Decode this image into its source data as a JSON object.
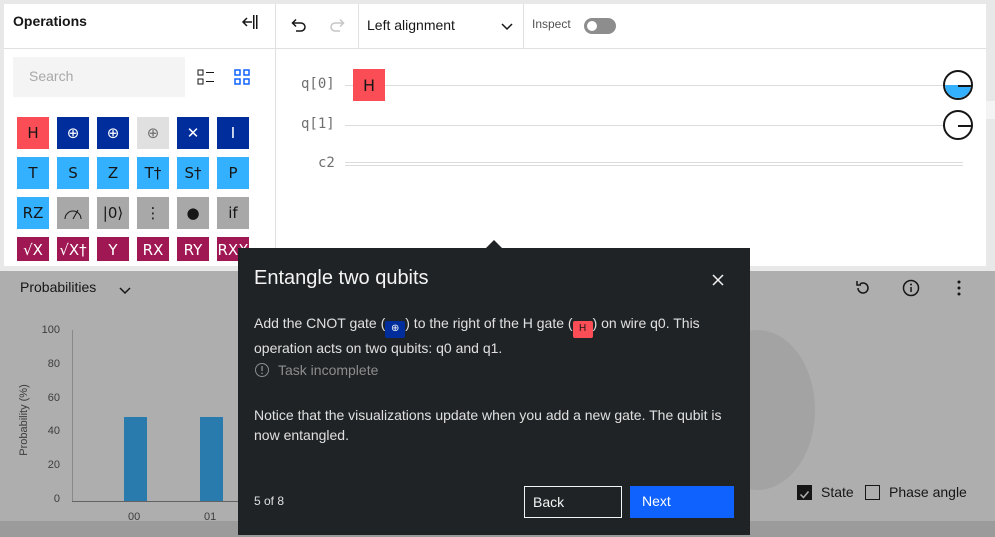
{
  "operations": {
    "title": "Operations",
    "search_placeholder": "Search",
    "gates": [
      {
        "label": "H",
        "style": "red"
      },
      {
        "label": "⊕",
        "style": "navy"
      },
      {
        "label": "⊕",
        "style": "navy",
        "control": true
      },
      {
        "label": "⊕",
        "style": "light",
        "control": true
      },
      {
        "label": "✕",
        "style": "navy",
        "swap": true
      },
      {
        "label": "I",
        "style": "navy"
      },
      {
        "label": "T",
        "style": "cyan"
      },
      {
        "label": "S",
        "style": "cyan"
      },
      {
        "label": "Z",
        "style": "cyan"
      },
      {
        "label": "T†",
        "style": "cyan"
      },
      {
        "label": "S†",
        "style": "cyan"
      },
      {
        "label": "P",
        "style": "cyan"
      },
      {
        "label": "RZ",
        "style": "cyan"
      },
      {
        "label": "meter-icon",
        "style": "gray",
        "icon": true
      },
      {
        "label": "|0⟩",
        "style": "gray"
      },
      {
        "label": "⋮",
        "style": "gray"
      },
      {
        "label": "●",
        "style": "gray"
      },
      {
        "label": "if",
        "style": "gray"
      },
      {
        "label": "√X",
        "style": "mag"
      },
      {
        "label": "√X†",
        "style": "mag"
      },
      {
        "label": "Y",
        "style": "mag"
      },
      {
        "label": "RX",
        "style": "mag"
      },
      {
        "label": "RY",
        "style": "mag"
      },
      {
        "label": "RXX",
        "style": "mag"
      }
    ]
  },
  "toolbar": {
    "alignment": "Left alignment",
    "inspect_label": "Inspect"
  },
  "circuit": {
    "wires": [
      "q[0]",
      "q[1]",
      "c2"
    ],
    "gate_h": "H"
  },
  "probabilities": {
    "title": "Probabilities",
    "ylabel": "Probability (%)",
    "yticks": [
      "100",
      "80",
      "60",
      "40",
      "20",
      "0"
    ],
    "xlabels": [
      "00",
      "01"
    ],
    "state_label": "State",
    "phase_label": "Phase angle"
  },
  "chart_data": {
    "type": "bar",
    "title": "Probabilities",
    "categories": [
      "00",
      "01"
    ],
    "values": [
      50,
      50
    ],
    "xlabel": "",
    "ylabel": "Probability (%)",
    "ylim": [
      0,
      100
    ]
  },
  "modal": {
    "title": "Entangle two qubits",
    "body_1": "Add the CNOT gate (",
    "body_2": ") to the right of the H gate (",
    "body_h": "H",
    "body_3": ") on wire q0. This operation acts on two qubits: q0 and q1.",
    "task_status": "Task incomplete",
    "note": "Notice that the visualizations update when you add a new gate. The qubit is now entangled.",
    "step": "5 of 8",
    "back_label": "Back",
    "next_label": "Next"
  },
  "colors": {
    "accent": "#0f62fe",
    "hgate": "#fa4d56",
    "bar": "#33b1ff",
    "modal_bg": "#1f2326"
  }
}
